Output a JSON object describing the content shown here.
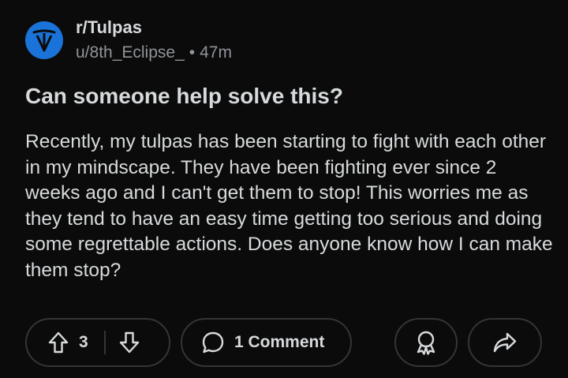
{
  "post": {
    "subreddit": "r/Tulpas",
    "author": "u/8th_Eclipse_",
    "separator": "•",
    "age": "47m",
    "title": "Can someone help solve this?",
    "body": "Recently, my tulpas has been starting to fight with each other in my mindscape. They have been fighting ever since 2 weeks ago and I can't get them to stop! This worries me as they tend to have an easy time getting too serious and doing some regrettable actions. Does anyone know how I can make them stop?"
  },
  "actions": {
    "vote_count": "3",
    "comments_label": "1 Comment"
  },
  "colors": {
    "background": "#0b0b0b",
    "text": "#d7dadc",
    "muted": "#8f9499",
    "border": "#343536",
    "avatar": "#1a73d9"
  },
  "icons": {
    "avatar": "tulpas-logo-icon",
    "upvote": "upvote-arrow-icon",
    "downvote": "downvote-arrow-icon",
    "comment": "comment-bubble-icon",
    "award": "award-icon",
    "share": "share-arrow-icon"
  }
}
